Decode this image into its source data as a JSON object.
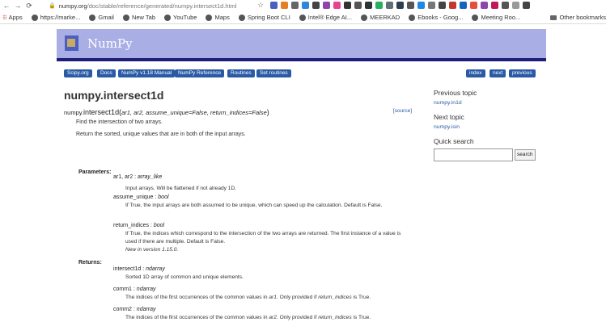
{
  "browser": {
    "url_host": "numpy.org",
    "url_path": "/doc/stable/reference/generated/numpy.intersect1d.html",
    "bookmarks": [
      "Apps",
      "https://marke...",
      "Gmail",
      "New Tab",
      "YouTube",
      "Maps",
      "Spring Boot CLI",
      "Intel® Edge AI...",
      "MEERKAD",
      "Ebooks - Goog...",
      "Meeting Roo..."
    ],
    "other_bookmarks": "Other bookmarks"
  },
  "site": {
    "brand": "NumPy",
    "nav_left": [
      "Scipy.org",
      "Docs",
      "NumPy v1.18 Manual",
      "NumPy Reference",
      "Routines",
      "Set routines"
    ],
    "nav_right": [
      "index",
      "next",
      "previous"
    ]
  },
  "doc": {
    "title": "numpy.intersect1d",
    "sig_prefix": "numpy.",
    "sig_name": "intersect1d",
    "sig_args": "ar1, ar2, assume_unique=False, return_indices=False",
    "source_link": "[source]",
    "summary": "Find the intersection of two arrays.",
    "summary2": "Return the sorted, unique values that are in both of the input arrays.",
    "params_label": "Parameters:",
    "returns_label": "Returns:",
    "params": [
      {
        "name": "ar1, ar2",
        "type": "array_like",
        "desc": "Input arrays. Will be flattened if not already 1D."
      },
      {
        "name": "assume_unique",
        "type": "bool",
        "desc": "If True, the input arrays are both assumed to be unique, which can speed up the calculation. Default is False."
      },
      {
        "name": "return_indices",
        "type": "bool",
        "desc": "If True, the indices which correspond to the intersection of the two arrays are returned. The first instance of a value is used if there are multiple. Default is False.",
        "note": "New in version 1.15.0."
      }
    ],
    "returns": [
      {
        "name": "intersect1d",
        "type": "ndarray",
        "desc": "Sorted 1D array of common and unique elements."
      },
      {
        "name": "comm1",
        "type": "ndarray",
        "desc_pre": "The indices of the first occurrences of the common values in ",
        "desc_em": "ar1",
        "desc_mid": ". Only provided if ",
        "desc_em2": "return_indices",
        "desc_post": " is True."
      },
      {
        "name": "comm2",
        "type": "ndarray",
        "desc_pre": "The indices of the first occurrences of the common values in ",
        "desc_em": "ar2",
        "desc_mid": ". Only provided if ",
        "desc_em2": "return_indices",
        "desc_post": " is True."
      }
    ]
  },
  "sidebar": {
    "prev_heading": "Previous topic",
    "prev_link": "numpy.in1d",
    "next_heading": "Next topic",
    "next_link": "numpy.isin",
    "search_heading": "Quick search",
    "search_button": "search"
  }
}
